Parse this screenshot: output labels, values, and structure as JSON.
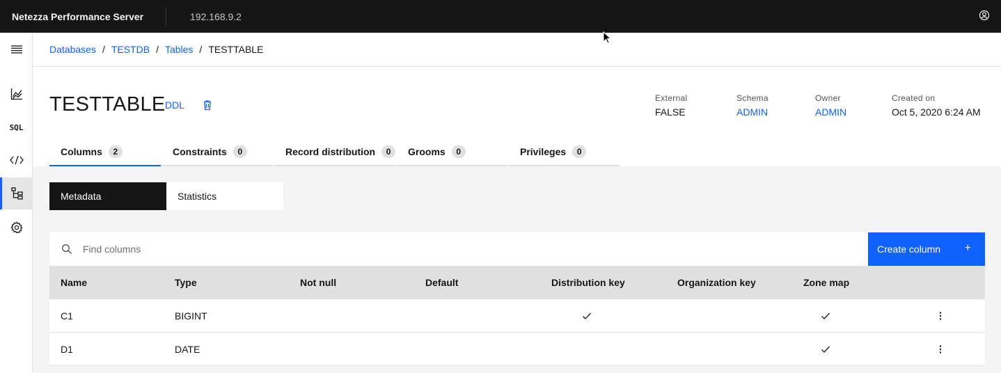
{
  "header": {
    "product": "Netezza Performance Server",
    "host": "192.168.9.2"
  },
  "breadcrumb": {
    "items": [
      "Databases",
      "TESTDB",
      "Tables"
    ],
    "current": "TESTTABLE",
    "separator": "/"
  },
  "page": {
    "title": "TESTTABLE",
    "ddl_label": "DDL",
    "meta": [
      {
        "label": "External",
        "value": "FALSE",
        "link": false
      },
      {
        "label": "Schema",
        "value": "ADMIN",
        "link": true
      },
      {
        "label": "Owner",
        "value": "ADMIN",
        "link": true
      },
      {
        "label": "Created on",
        "value": "Oct 5, 2020 6:24 AM",
        "link": false
      }
    ]
  },
  "tabs": [
    {
      "label": "Columns",
      "count": "2",
      "active": true
    },
    {
      "label": "Constraints",
      "count": "0",
      "active": false
    },
    {
      "label": "Record distribution",
      "count": "0",
      "active": false
    },
    {
      "label": "Grooms",
      "count": "0",
      "active": false
    },
    {
      "label": "Privileges",
      "count": "0",
      "active": false
    }
  ],
  "switcher": {
    "metadata": "Metadata",
    "statistics": "Statistics"
  },
  "toolbar": {
    "search_placeholder": "Find columns",
    "search_value": "",
    "create_label": "Create column",
    "create_icon": "+"
  },
  "table": {
    "headers": [
      "Name",
      "Type",
      "Not null",
      "Default",
      "Distribution key",
      "Organization key",
      "Zone map"
    ],
    "rows": [
      {
        "name": "C1",
        "type": "BIGINT",
        "not_null": false,
        "default": "",
        "distribution_key": true,
        "organization_key": false,
        "zone_map": true
      },
      {
        "name": "D1",
        "type": "DATE",
        "not_null": false,
        "default": "",
        "distribution_key": false,
        "organization_key": false,
        "zone_map": true
      }
    ]
  },
  "icons": {
    "nav": [
      "menu-icon",
      "chart-icon",
      "sql-icon",
      "code-icon",
      "tree-icon",
      "settings-icon"
    ],
    "sql_glyph": "SQL"
  },
  "colors": {
    "accent": "#0f62fe",
    "header_bg": "#161616"
  }
}
